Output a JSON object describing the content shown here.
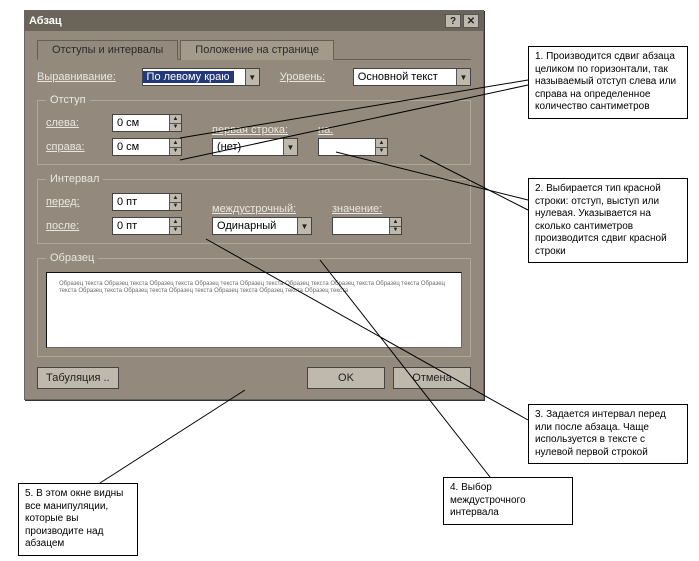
{
  "dialog": {
    "title": "Абзац",
    "tabs": {
      "active": "Отступы и интервалы",
      "other": "Положение на странице"
    },
    "align": {
      "label": "Выравнивание:",
      "value": "По левому краю"
    },
    "level": {
      "label": "Уровень:",
      "value": "Основной текст"
    },
    "indent": {
      "legend": "Отступ",
      "left": {
        "label": "слева:",
        "value": "0 см"
      },
      "right": {
        "label": "справа:",
        "value": "0 см"
      },
      "firstline": {
        "label": "первая строка:",
        "value": "(нет)"
      },
      "by": {
        "label": "на:",
        "value": ""
      }
    },
    "spacing": {
      "legend": "Интервал",
      "before": {
        "label": "перед:",
        "value": "0 пт"
      },
      "after": {
        "label": "после:",
        "value": "0 пт"
      },
      "line": {
        "label": "междустрочный:",
        "value": "Одинарный"
      },
      "at": {
        "label": "значение:",
        "value": ""
      }
    },
    "preview": {
      "legend": "Образец",
      "text": "Образец текста Образец текста Образец текста Образец текста Образец текста Образец текста Образец текста Образец текста Образец текста Образец текста Образец текста Образец текста Образец текста Образец текста Образец текста"
    },
    "buttons": {
      "tabstops": "Табуляция ..",
      "ok": "OK",
      "cancel": "Отмена"
    }
  },
  "callouts": {
    "c1": "1. Производится сдвиг абзаца целиком по горизонтали, так называемый отступ слева или справа на определенное количество сантиметров",
    "c2": "2. Выбирается тип красной строки: отступ, выступ или нулевая. Указывается на сколько сантиметров производится сдвиг красной строки",
    "c3": "3. Задается интервал перед или после абзаца. Чаще используется в тексте с нулевой первой строкой",
    "c4": "4. Выбор междустрочного интервала",
    "c5": "5. В этом окне видны все манипуляции, которые вы производите над абзацем"
  }
}
